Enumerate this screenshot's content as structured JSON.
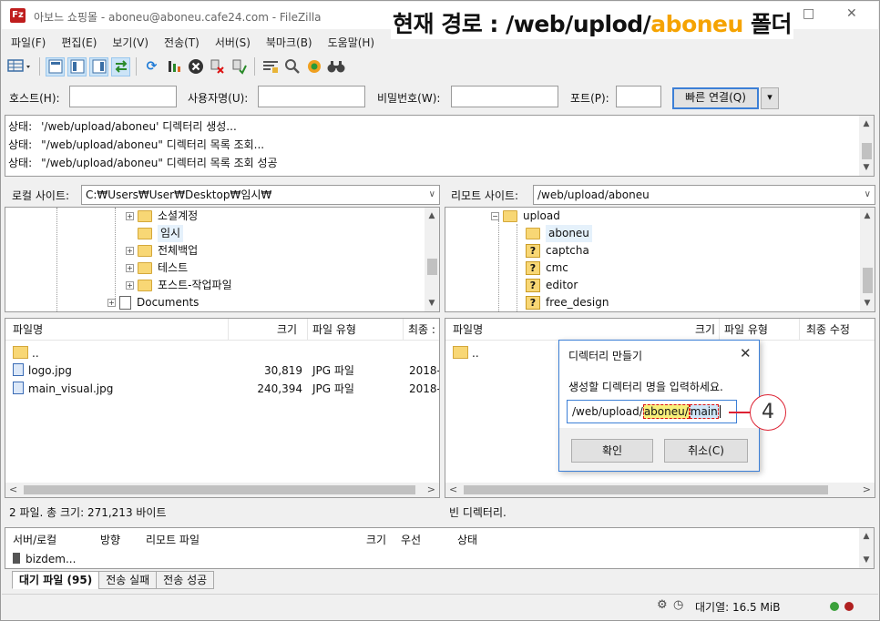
{
  "window": {
    "title": "아보느 쇼핑몰 - aboneu@aboneu.cafe24.com - FileZilla",
    "app_icon_text": "Fz",
    "min": "—",
    "max": "□",
    "close": "✕"
  },
  "annotation": {
    "title_prefix": "현재 경로 : /web/uplod/",
    "title_highlight": "aboneu",
    "title_suffix": " 폴더",
    "step_number": "4",
    "highlight_color": "#f5a300"
  },
  "menu": [
    "파일(F)",
    "편집(E)",
    "보기(V)",
    "전송(T)",
    "서버(S)",
    "북마크(B)",
    "도움말(H)"
  ],
  "quickconnect": {
    "host_label": "호스트(H):",
    "user_label": "사용자명(U):",
    "pass_label": "비밀번호(W):",
    "port_label": "포트(P):",
    "host_value": "",
    "user_value": "",
    "pass_value": "",
    "port_value": "",
    "connect_button": "빠른 연결(Q)",
    "dropdown_icon": "▾"
  },
  "log": [
    {
      "prefix": "상태:",
      "text": "'/web/upload/aboneu' 디렉터리 생성..."
    },
    {
      "prefix": "상태:",
      "text": "\"/web/upload/aboneu\" 디렉터리 목록 조회..."
    },
    {
      "prefix": "상태:",
      "text": "\"/web/upload/aboneu\" 디렉터리 목록 조회 성공"
    }
  ],
  "local": {
    "site_label": "로컬 사이트:",
    "path": "C:₩Users₩User₩Desktop₩임시₩",
    "tree": [
      {
        "label": "소셜계정",
        "expander": "+"
      },
      {
        "label": "임시",
        "expander": ""
      },
      {
        "label": "전체백업",
        "expander": "+"
      },
      {
        "label": "테스트",
        "expander": "+"
      },
      {
        "label": "포스트-작업파일",
        "expander": "+"
      },
      {
        "label": "Documents",
        "expander": "+"
      }
    ],
    "headers": {
      "name": "파일명",
      "size": "크기",
      "type": "파일 유형",
      "modified": "최종 :"
    },
    "files": [
      {
        "name": "..",
        "size": "",
        "type": "",
        "modified": ""
      },
      {
        "name": "logo.jpg",
        "size": "30,819",
        "type": "JPG 파일",
        "modified": "2018-"
      },
      {
        "name": "main_visual.jpg",
        "size": "240,394",
        "type": "JPG 파일",
        "modified": "2018-"
      }
    ],
    "status": "2 파일. 총 크기: 271,213 바이트"
  },
  "remote": {
    "site_label": "리모트 사이트:",
    "path": "/web/upload/aboneu",
    "tree": [
      {
        "label": "upload",
        "expander": "−",
        "icon": "folder"
      },
      {
        "label": "aboneu",
        "expander": "",
        "icon": "folder"
      },
      {
        "label": "captcha",
        "expander": "",
        "icon": "unknown"
      },
      {
        "label": "cmc",
        "expander": "",
        "icon": "unknown"
      },
      {
        "label": "editor",
        "expander": "",
        "icon": "unknown"
      },
      {
        "label": "free_design",
        "expander": "",
        "icon": "unknown"
      }
    ],
    "unknown_mark": "?",
    "headers": {
      "name": "파일명",
      "size": "크기",
      "type": "파일 유형",
      "modified": "최종 수정"
    },
    "files": [
      {
        "name": ".."
      }
    ],
    "status": "빈 디렉터리."
  },
  "dialog": {
    "title": "디렉터리 만들기",
    "close": "✕",
    "prompt": "생성할 디렉터리 명을 입력하세요.",
    "input_part1": "/web/upload/",
    "input_part2": "aboneu/",
    "input_part3": "main",
    "ok_button": "확인",
    "cancel_button": "취소(C)"
  },
  "queue": {
    "headers": {
      "server_local": "서버/로컬",
      "direction": "방향",
      "remote_file": "리모트 파일",
      "size": "크기",
      "priority": "우선",
      "status": "상태"
    },
    "row_text": "bizdem...",
    "tabs": [
      {
        "label": "대기 파일 (95)",
        "active": true
      },
      {
        "label": "전송 실패",
        "active": false
      },
      {
        "label": "전송 성공",
        "active": false
      }
    ]
  },
  "statusbar": {
    "queue_text": "대기열: 16.5 MiB"
  }
}
